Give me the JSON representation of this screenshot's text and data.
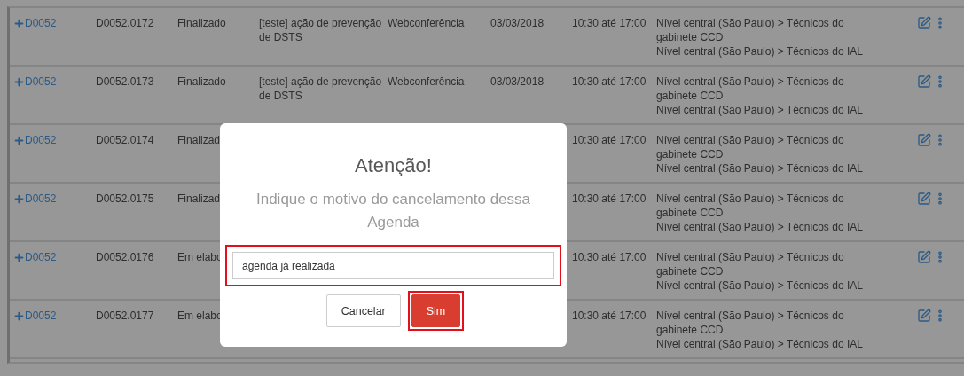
{
  "rows": [
    {
      "code": "D0052",
      "id": "D0052.0172",
      "status": "Finalizado",
      "title": "[teste] ação de prevenção de DSTS",
      "mode": "Webconferência",
      "date": "03/03/2018",
      "time": "10:30 até 17:00",
      "groups": [
        "Nível central (São Paulo) > Técnicos do gabinete CCD",
        "Nível central (São Paulo) > Técnicos do IAL"
      ]
    },
    {
      "code": "D0052",
      "id": "D0052.0173",
      "status": "Finalizado",
      "title": "[teste] ação de prevenção de DSTS",
      "mode": "Webconferência",
      "date": "03/03/2018",
      "time": "10:30 até 17:00",
      "groups": [
        "Nível central (São Paulo) > Técnicos do gabinete CCD",
        "Nível central (São Paulo) > Técnicos do IAL"
      ]
    },
    {
      "code": "D0052",
      "id": "D0052.0174",
      "status": "Finalizad",
      "time": "10:30 até 17:00",
      "groups": [
        "Nível central (São Paulo) > Técnicos do gabinete CCD",
        "Nível central (São Paulo) > Técnicos do IAL"
      ]
    },
    {
      "code": "D0052",
      "id": "D0052.0175",
      "status": "Finalizad",
      "time": "10:30 até 17:00",
      "groups": [
        "Nível central (São Paulo) > Técnicos do gabinete CCD",
        "Nível central (São Paulo) > Técnicos do IAL"
      ]
    },
    {
      "code": "D0052",
      "id": "D0052.0176",
      "status": "Em elabo",
      "time": "10:30 até 17:00",
      "groups": [
        "Nível central (São Paulo) > Técnicos do gabinete CCD",
        "Nível central (São Paulo) > Técnicos do IAL"
      ]
    },
    {
      "code": "D0052",
      "id": "D0052.0177",
      "status": "Em elabo",
      "time": "10:30 até 17:00",
      "groups": [
        "Nível central (São Paulo) > Técnicos do gabinete CCD",
        "Nível central (São Paulo) > Técnicos do IAL"
      ]
    }
  ],
  "dialog": {
    "title": "Atenção!",
    "message": "Indique o motivo do cancelamento dessa Agenda",
    "input": {
      "value": "agenda já realizada",
      "highlighted": true
    },
    "buttons": [
      {
        "label": "Cancelar",
        "kind": "secondary",
        "highlighted": false
      },
      {
        "label": "Sim",
        "kind": "primary",
        "highlighted": true
      }
    ]
  }
}
